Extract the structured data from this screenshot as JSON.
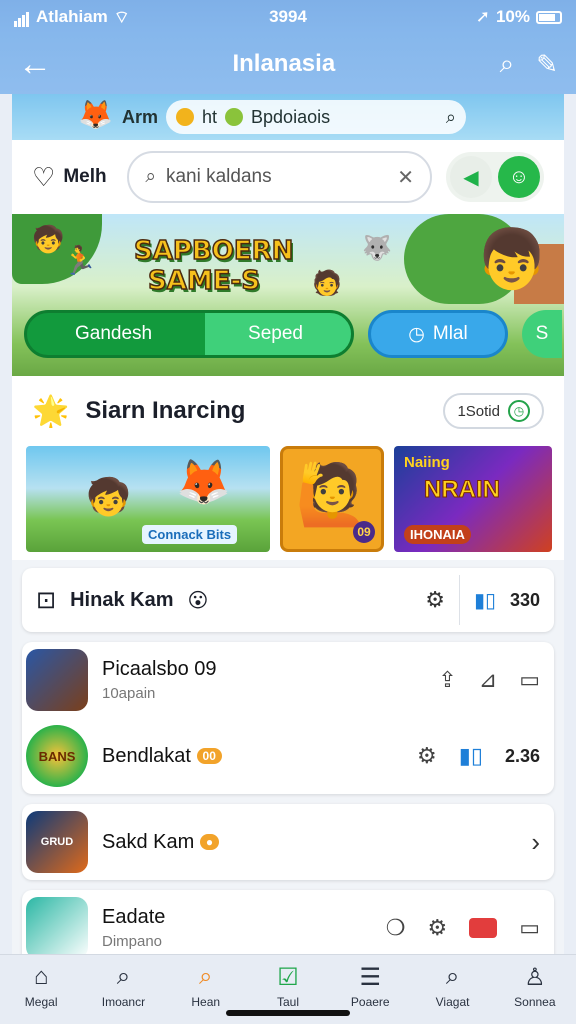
{
  "status": {
    "carrier": "Atlahiam",
    "time": "3994",
    "battery": "10%"
  },
  "appbar": {
    "title": "Inlanasia"
  },
  "topbar": {
    "brand": "Arm",
    "pill_text": "ht",
    "pill_text2": "Bpdoiaois"
  },
  "search": {
    "left_label": "Melh",
    "placeholder": "kani kaldans"
  },
  "banner": {
    "logo": "SAPBOERN SAME-S",
    "tabs": [
      "Gandesh",
      "Seped",
      "Mlal",
      "S"
    ]
  },
  "section": {
    "title": "Siarn Inarcing",
    "button": "1Sotid"
  },
  "carousel": {
    "tile1_label": "Connack Bits",
    "tile2_num": "09",
    "tile3_title": "Naiing",
    "tile3_title2": "NRAIN",
    "tile3_sub": "IHONAIA"
  },
  "list": {
    "bar": {
      "name": "Hinak Kam",
      "stat": "330"
    },
    "games": [
      {
        "title": "Picaalsbo 09",
        "sub": "10apain",
        "icon_text": ""
      },
      {
        "title": "Bendlakat",
        "badge": "00",
        "stat": "2.36",
        "icon_text": "BANS"
      },
      {
        "title": "Sakd Kam",
        "icon_text": "GRUD"
      },
      {
        "title": "Eadate",
        "sub": "Dimpano",
        "icon_text": ""
      }
    ]
  },
  "nav": [
    {
      "label": "Megal",
      "icon": "home-icon"
    },
    {
      "label": "Imoancr",
      "icon": "search-icon"
    },
    {
      "label": "Hean",
      "icon": "search-icon"
    },
    {
      "label": "Taul",
      "icon": "check-icon"
    },
    {
      "label": "Poaere",
      "icon": "list-icon"
    },
    {
      "label": "Viagat",
      "icon": "search-icon"
    },
    {
      "label": "Sonnea",
      "icon": "person-icon"
    }
  ]
}
